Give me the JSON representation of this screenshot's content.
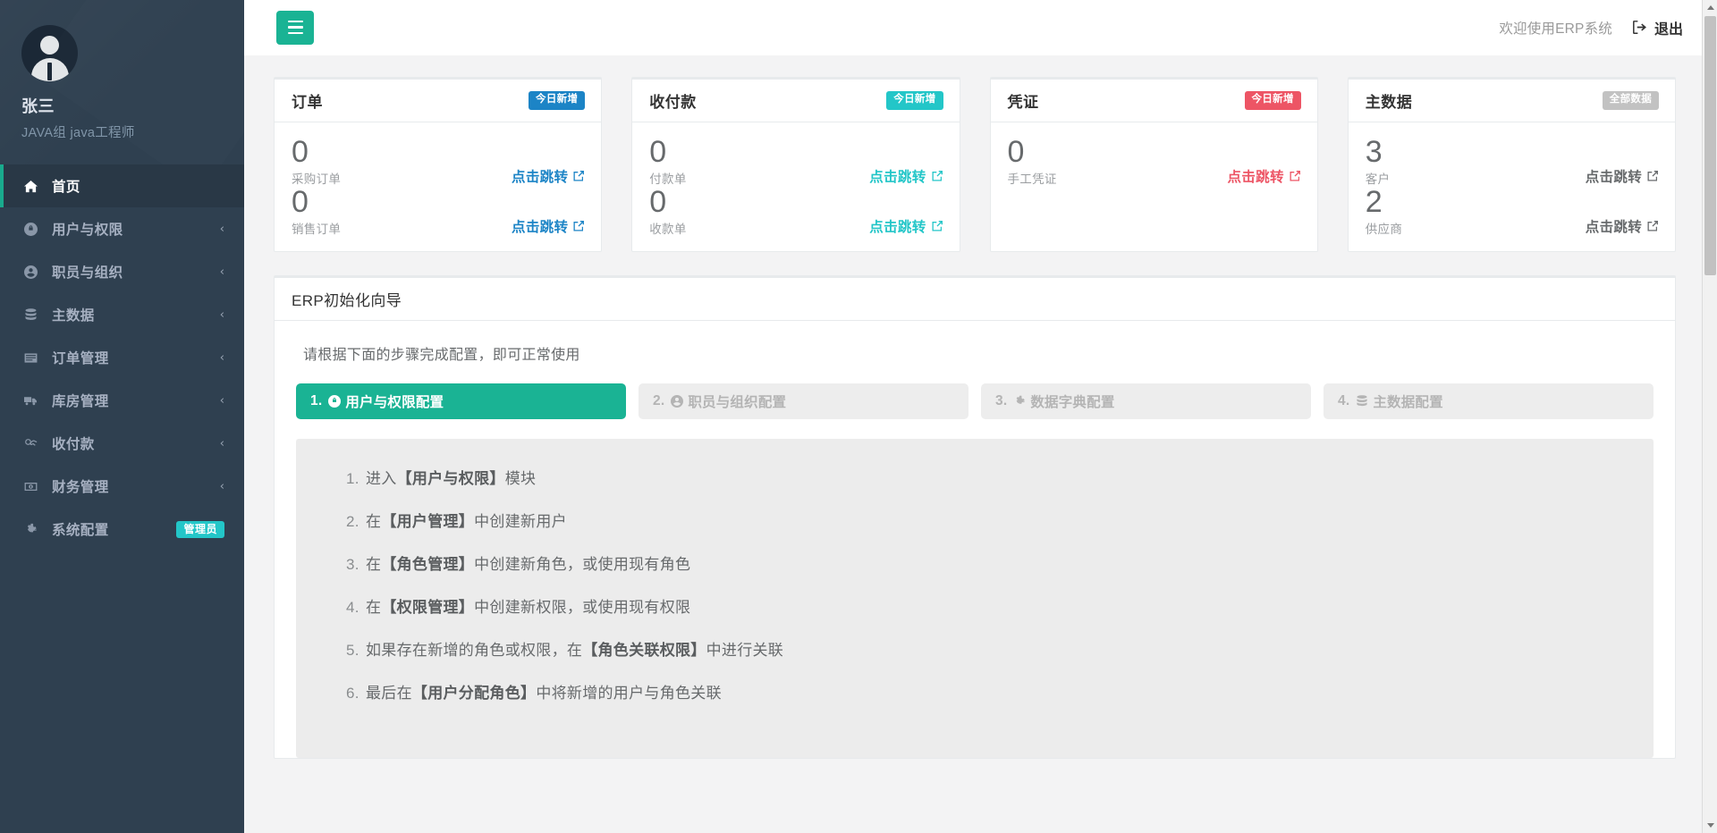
{
  "colors": {
    "sidebar_bg": "#2f4050",
    "sidebar_active_bg": "#293846",
    "accent_green": "#1ab394",
    "accent_teal": "#23c6c8",
    "accent_blue": "#1c84c6",
    "accent_red": "#ed5565",
    "muted_gray": "#c2c2c2"
  },
  "sidebar": {
    "profile": {
      "name": "张三",
      "role": "JAVA组 java工程师",
      "avatar_icon": "user-avatar-icon"
    },
    "items": [
      {
        "label": "首页",
        "icon": "home-icon",
        "active": true,
        "chevron": "",
        "badge": ""
      },
      {
        "label": "用户与权限",
        "icon": "shield-lock-icon",
        "active": false,
        "chevron": "‹",
        "badge": ""
      },
      {
        "label": "职员与组织",
        "icon": "user-circle-icon",
        "active": false,
        "chevron": "‹",
        "badge": ""
      },
      {
        "label": "主数据",
        "icon": "database-icon",
        "active": false,
        "chevron": "‹",
        "badge": ""
      },
      {
        "label": "订单管理",
        "icon": "list-box-icon",
        "active": false,
        "chevron": "‹",
        "badge": ""
      },
      {
        "label": "库房管理",
        "icon": "truck-icon",
        "active": false,
        "chevron": "‹",
        "badge": ""
      },
      {
        "label": "收付款",
        "icon": "handshake-icon",
        "active": false,
        "chevron": "‹",
        "badge": ""
      },
      {
        "label": "财务管理",
        "icon": "money-icon",
        "active": false,
        "chevron": "‹",
        "badge": ""
      },
      {
        "label": "系统配置",
        "icon": "gear-icon",
        "active": false,
        "chevron": "",
        "badge": "管理员"
      }
    ]
  },
  "topbar": {
    "menu_icon": "hamburger-icon",
    "welcome_text": "欢迎使用ERP系统",
    "logout_label": "退出",
    "logout_icon": "sign-out-icon"
  },
  "cards": [
    {
      "title": "订单",
      "badge": "今日新增",
      "badge_color": "#1c84c6",
      "link_color": "#1c84c6",
      "stats": [
        {
          "value": "0",
          "label": "采购订单",
          "link": "点击跳转",
          "link_icon": "external-link-icon"
        },
        {
          "value": "0",
          "label": "销售订单",
          "link": "点击跳转",
          "link_icon": "external-link-icon"
        }
      ]
    },
    {
      "title": "收付款",
      "badge": "今日新增",
      "badge_color": "#23c6c8",
      "link_color": "#23c6c8",
      "stats": [
        {
          "value": "0",
          "label": "付款单",
          "link": "点击跳转",
          "link_icon": "external-link-icon"
        },
        {
          "value": "0",
          "label": "收款单",
          "link": "点击跳转",
          "link_icon": "external-link-icon"
        }
      ]
    },
    {
      "title": "凭证",
      "badge": "今日新增",
      "badge_color": "#ed5565",
      "link_color": "#ed5565",
      "stats": [
        {
          "value": "0",
          "label": "手工凭证",
          "link": "点击跳转",
          "link_icon": "external-link-icon"
        }
      ]
    },
    {
      "title": "主数据",
      "badge": "全部数据",
      "badge_color": "#c2c2c2",
      "link_color": "#676a6c",
      "stats": [
        {
          "value": "3",
          "label": "客户",
          "link": "点击跳转",
          "link_icon": "external-link-icon"
        },
        {
          "value": "2",
          "label": "供应商",
          "link": "点击跳转",
          "link_icon": "external-link-icon"
        }
      ]
    }
  ],
  "wizard": {
    "panel_title": "ERP初始化向导",
    "hint": "请根据下面的步骤完成配置，即可正常使用",
    "steps": [
      {
        "number": "1.",
        "label": "用户与权限配置",
        "icon": "shield-lock-icon",
        "active": true
      },
      {
        "number": "2.",
        "label": "职员与组织配置",
        "icon": "user-circle-icon",
        "active": false
      },
      {
        "number": "3.",
        "label": "数据字典配置",
        "icon": "gear-icon",
        "active": false
      },
      {
        "number": "4.",
        "label": "主数据配置",
        "icon": "database-icon",
        "active": false
      }
    ],
    "instructions": [
      {
        "prefix": "进入",
        "strong": "【用户与权限】",
        "suffix": "模块"
      },
      {
        "prefix": "在",
        "strong": "【用户管理】",
        "suffix": "中创建新用户"
      },
      {
        "prefix": "在",
        "strong": "【角色管理】",
        "suffix": "中创建新角色，或使用现有角色"
      },
      {
        "prefix": "在",
        "strong": "【权限管理】",
        "suffix": "中创建新权限，或使用现有权限"
      },
      {
        "prefix": "如果存在新增的角色或权限，在",
        "strong": "【角色关联权限】",
        "suffix": "中进行关联"
      },
      {
        "prefix": "最后在",
        "strong": "【用户分配角色】",
        "suffix": "中将新增的用户与角色关联"
      }
    ]
  },
  "scrollbar": {
    "up_icon": "caret-up-icon",
    "down_icon": "caret-down-icon"
  }
}
